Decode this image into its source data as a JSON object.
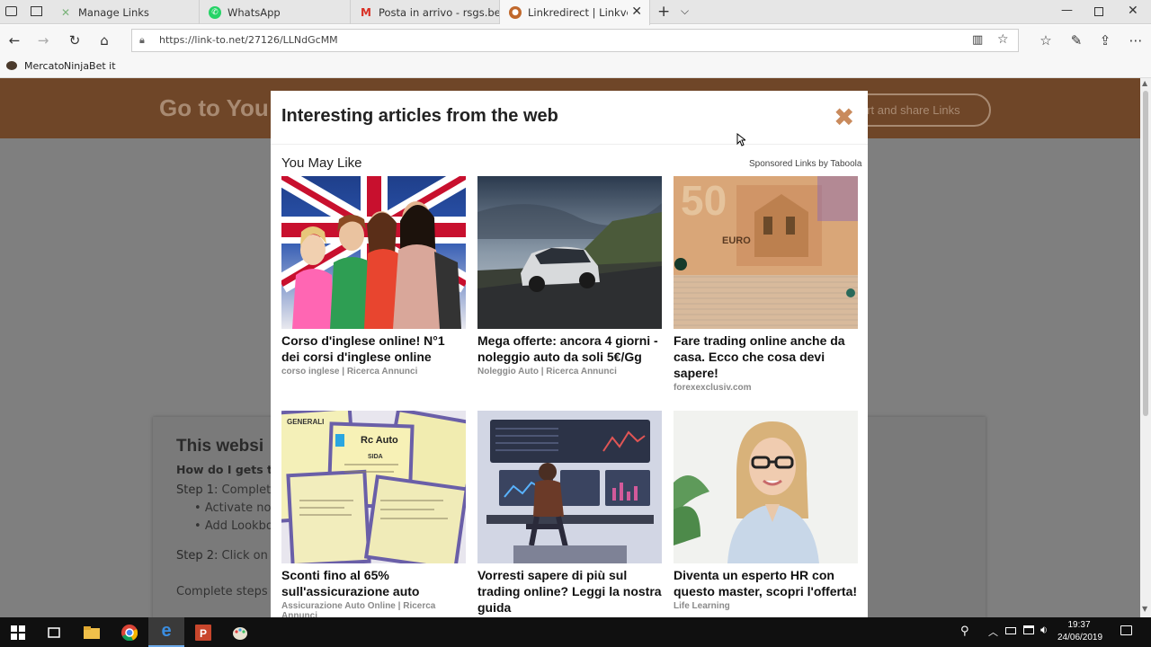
{
  "tabs": [
    {
      "label": "Manage Links",
      "icon": "manage-links-favicon"
    },
    {
      "label": "WhatsApp",
      "icon": "whatsapp-favicon"
    },
    {
      "label": "Posta in arrivo - rsgs.beraldi",
      "icon": "gmail-favicon"
    },
    {
      "label": "Linkredirect | Linkvertise",
      "icon": "linkvertise-favicon"
    }
  ],
  "address": {
    "url": "https://link-to.net/27126/LLNdGcMM"
  },
  "favorites": [
    {
      "label": "Mercato"
    },
    {
      "label": "NinjaBet it"
    }
  ],
  "page": {
    "header_title": "Go to You",
    "header_button": "ort and share Links",
    "body_title": "This websi",
    "question": "How do I gets to",
    "step1": "Step 1:",
    "step1_text": "Complete",
    "bullet1": "Activate not",
    "bullet2": "Add Lookbo",
    "step2": "Step 2:",
    "step2_text": "Click on th",
    "footer": "Complete steps a"
  },
  "modal": {
    "title": "Interesting articles from the web",
    "section": "You May Like",
    "sponsor": "Sponsored Links by Taboola",
    "articles": [
      {
        "title": "Corso d'inglese online! N°1 dei corsi d'inglese online",
        "source": "corso inglese | Ricerca Annunci"
      },
      {
        "title": "Mega offerte: ancora 4 giorni - noleggio auto da soli 5€/Gg",
        "source": "Noleggio Auto | Ricerca Annunci"
      },
      {
        "title": "Fare trading online anche da casa. Ecco che cosa devi sapere!",
        "source": "forexexclusiv.com"
      },
      {
        "title": "Sconti fino al 65% sull'assicurazione auto",
        "source": "Assicurazione Auto Online | Ricerca Annunci"
      },
      {
        "title": "Vorresti sapere di più sul trading online? Leggi la nostra guida",
        "source": ""
      },
      {
        "title": "Diventa un esperto HR con questo master, scopri l'offerta!",
        "source": "Life Learning"
      }
    ],
    "thumb_text": {
      "insurance_label": "Rc Auto",
      "insurance_brand": "GENERALI",
      "insurance_sida": "SIDA",
      "banknote_value": "50",
      "banknote_euro": "EURO"
    }
  },
  "taskbar": {
    "time": "19:37",
    "date": "24/06/2019"
  },
  "colors": {
    "header_brown": "#6f4628",
    "close_x": "#c98a5c",
    "page_overlay": "#7f7f7f"
  }
}
